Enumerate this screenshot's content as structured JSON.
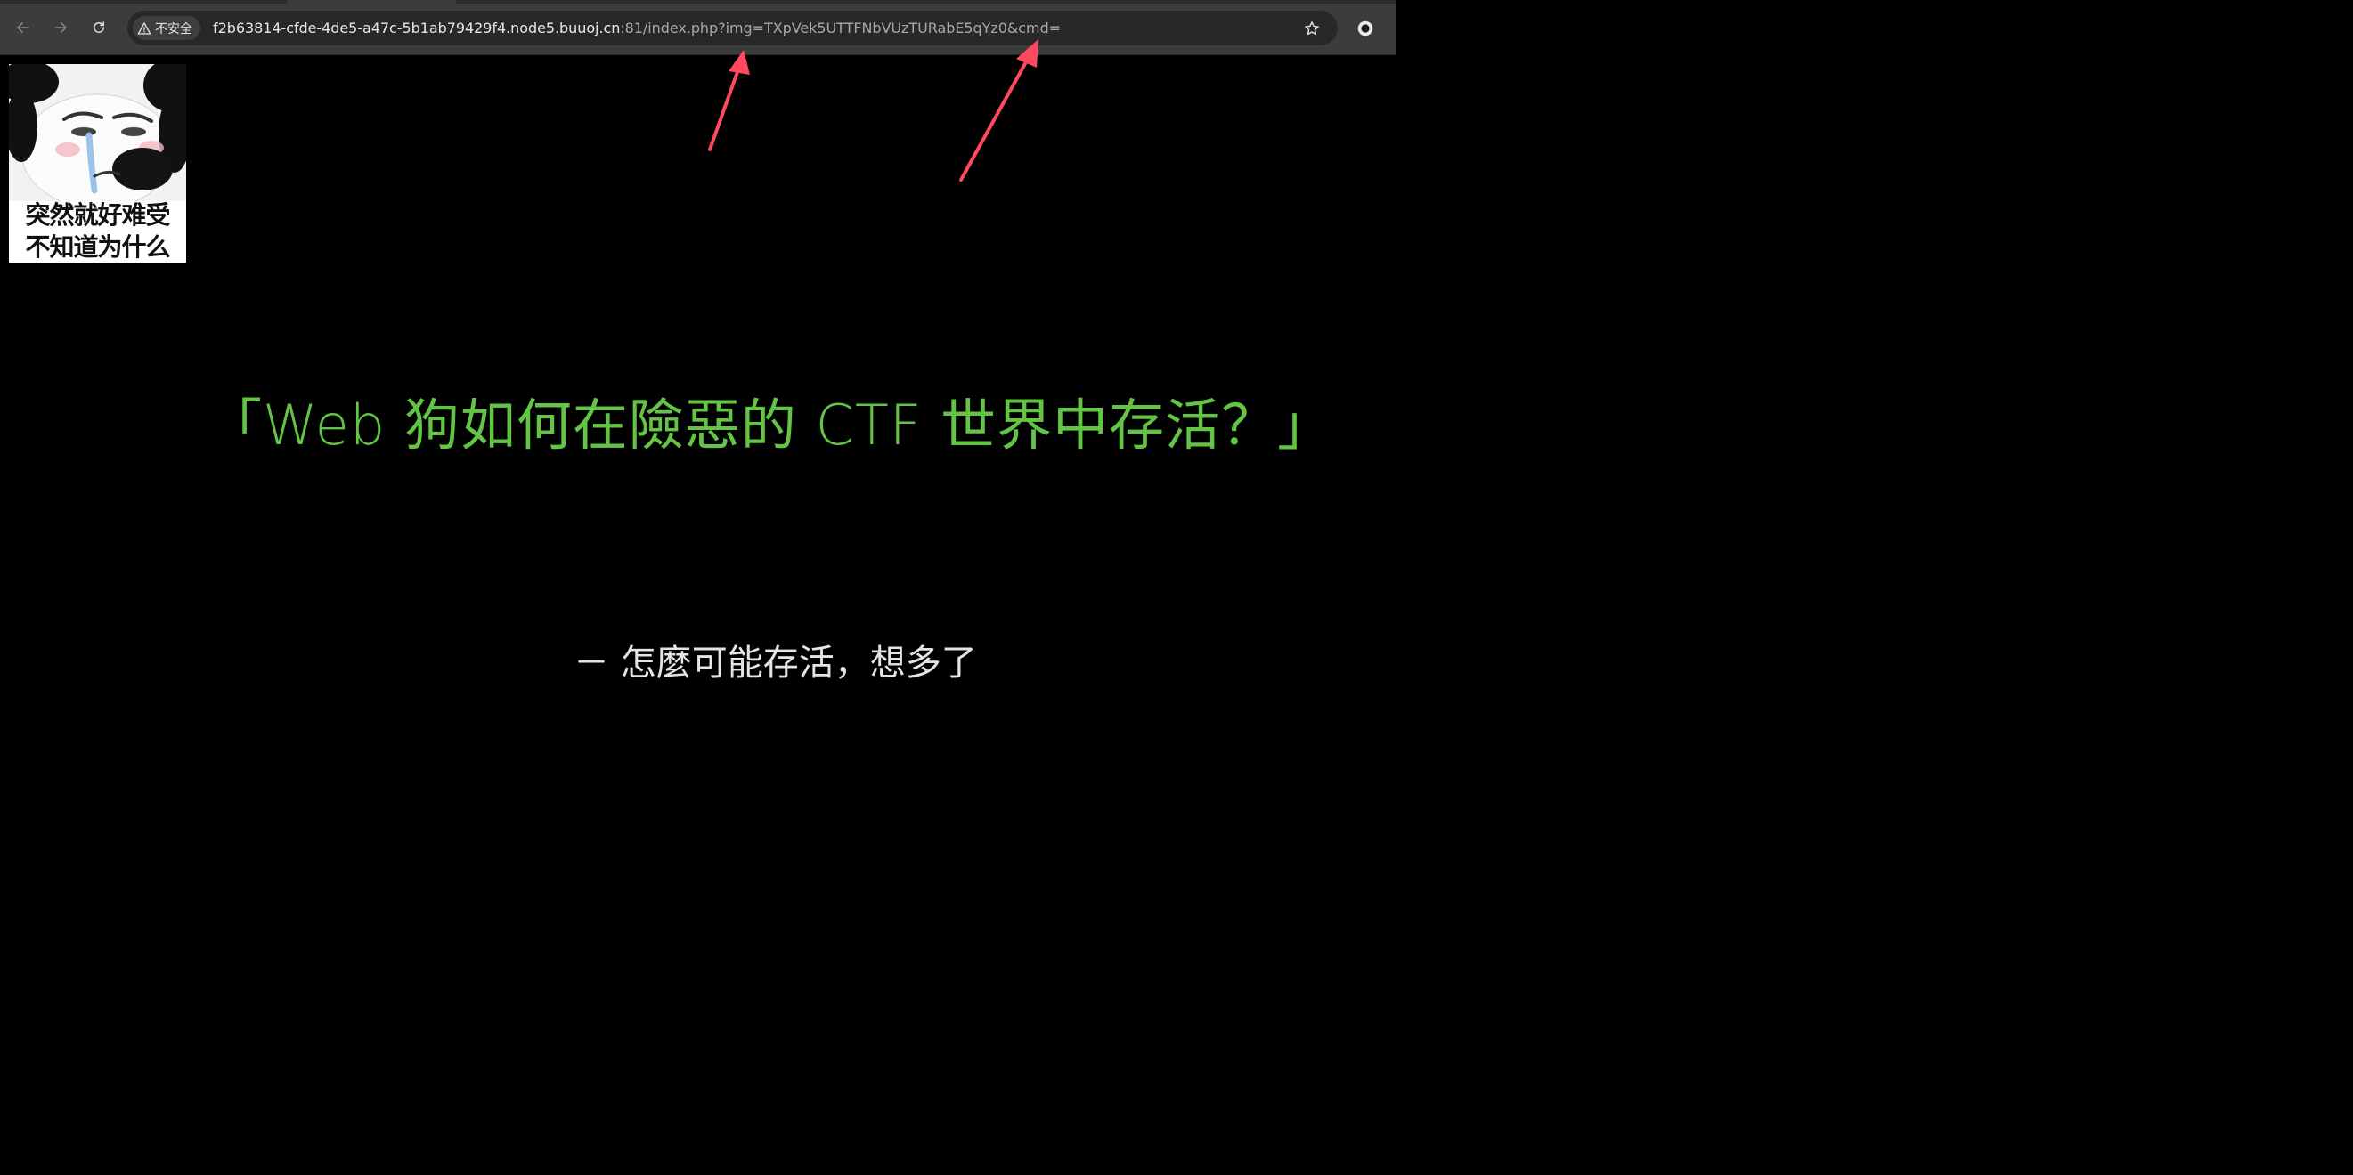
{
  "browser": {
    "security_label": "不安全",
    "url_host": "f2b63814-cfde-4de5-a47c-5b1ab79429f4.node5.buuoj.cn",
    "url_rest": ":81/index.php?img=TXpVek5UTTFNbVUzTURabE5qYz0&cmd=",
    "icons": {
      "back": "arrow-left-icon",
      "forward": "arrow-right-icon",
      "reload": "reload-icon",
      "security": "warning-triangle-icon",
      "bookmark": "star-icon",
      "extension": "circle-extension-icon"
    }
  },
  "page": {
    "meme": {
      "caption_line1": "突然就好难受",
      "caption_line2": "不知道为什么"
    },
    "headline": "「Web 狗如何在險惡的 CTF 世界中存活？」",
    "subline": "－ 怎麼可能存活，想多了"
  },
  "colors": {
    "headline": "#62c544",
    "annotation_arrow": "#ff4a5e",
    "page_background": "#000000"
  }
}
